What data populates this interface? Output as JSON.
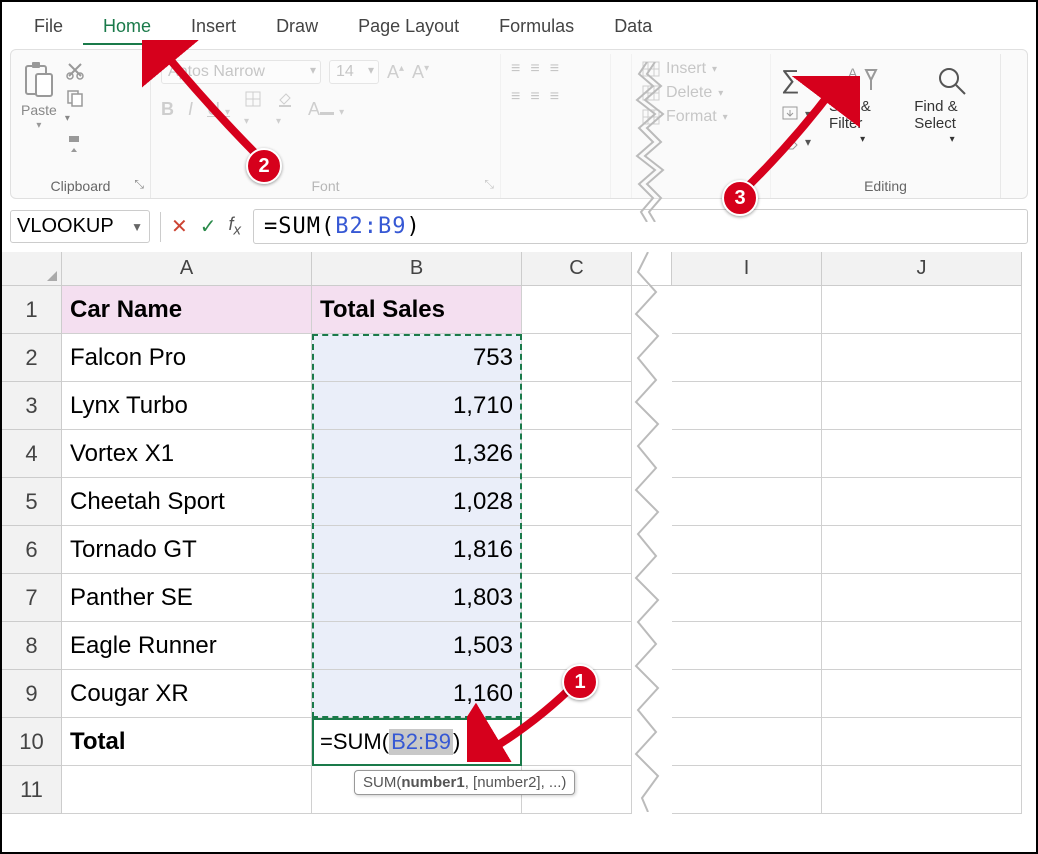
{
  "menubar": [
    "File",
    "Home",
    "Insert",
    "Draw",
    "Page Layout",
    "Formulas",
    "Data"
  ],
  "active_tab": "Home",
  "ribbon": {
    "clipboard_label": "Clipboard",
    "paste_label": "Paste",
    "font_label": "Font",
    "font_name": "Aptos Narrow",
    "font_size": "14",
    "cells": {
      "insert": "Insert",
      "delete": "Delete",
      "format": "Format"
    },
    "editing_label": "Editing",
    "sort_filter": "Sort & Filter",
    "find_select": "Find & Select"
  },
  "name_box": "VLOOKUP",
  "formula": {
    "prefix": "=SUM(",
    "range": "B2:B9",
    "suffix": ")"
  },
  "columns": [
    "A",
    "B",
    "C",
    "I",
    "J"
  ],
  "row_numbers": [
    "1",
    "2",
    "3",
    "4",
    "5",
    "6",
    "7",
    "8",
    "9",
    "10",
    "11"
  ],
  "headers": {
    "a": "Car Name",
    "b": "Total Sales"
  },
  "rows": [
    {
      "name": "Falcon Pro",
      "sales": "753"
    },
    {
      "name": "Lynx Turbo",
      "sales": "1,710"
    },
    {
      "name": "Vortex X1",
      "sales": "1,326"
    },
    {
      "name": "Cheetah Sport",
      "sales": "1,028"
    },
    {
      "name": "Tornado GT",
      "sales": "1,816"
    },
    {
      "name": "Panther SE",
      "sales": "1,803"
    },
    {
      "name": "Eagle Runner",
      "sales": "1,503"
    },
    {
      "name": "Cougar XR",
      "sales": "1,160"
    }
  ],
  "total_label": "Total",
  "cell_formula": {
    "prefix": "=SUM(",
    "range": "B2:B9",
    "suffix": ")"
  },
  "tooltip": {
    "fn": "SUM",
    "arg1": "number1",
    "rest": ", [number2], ...)"
  },
  "badges": {
    "b1": "1",
    "b2": "2",
    "b3": "3"
  }
}
